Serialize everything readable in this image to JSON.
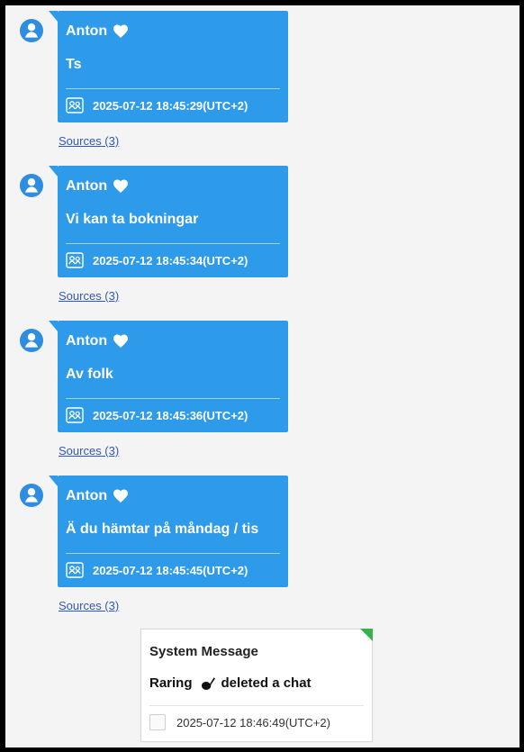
{
  "messages": [
    {
      "sender": "Anton",
      "text": "Ts",
      "timestamp": "2025-07-12 18:45:29(UTC+2)",
      "sources": "Sources (3)"
    },
    {
      "sender": "Anton",
      "text": "Vi kan ta bokningar",
      "timestamp": "2025-07-12 18:45:34(UTC+2)",
      "sources": "Sources (3)"
    },
    {
      "sender": "Anton",
      "text": "Av folk",
      "timestamp": "2025-07-12 18:45:36(UTC+2)",
      "sources": "Sources (3)"
    },
    {
      "sender": "Anton",
      "text": "Ä du hämtar på måndag / tis",
      "timestamp": "2025-07-12 18:45:45(UTC+2)",
      "sources": "Sources (3)"
    }
  ],
  "system_message": {
    "title": "System Message",
    "name": "Raring",
    "action": "deleted a chat",
    "timestamp": "2025-07-12 18:46:49(UTC+2)"
  },
  "colors": {
    "bubble": "#2d9bea",
    "avatar": "#2f8de0",
    "link": "#3158b8",
    "system_accent": "#38b24a",
    "outer_frame": "#000000",
    "chat_background": "#f4f4f4"
  },
  "icons": {
    "avatar": "user-avatar-icon",
    "heart": "heart-icon",
    "meta": "contacts-icon",
    "system_action": "drop-icon",
    "system_meta": "checkbox-icon"
  }
}
